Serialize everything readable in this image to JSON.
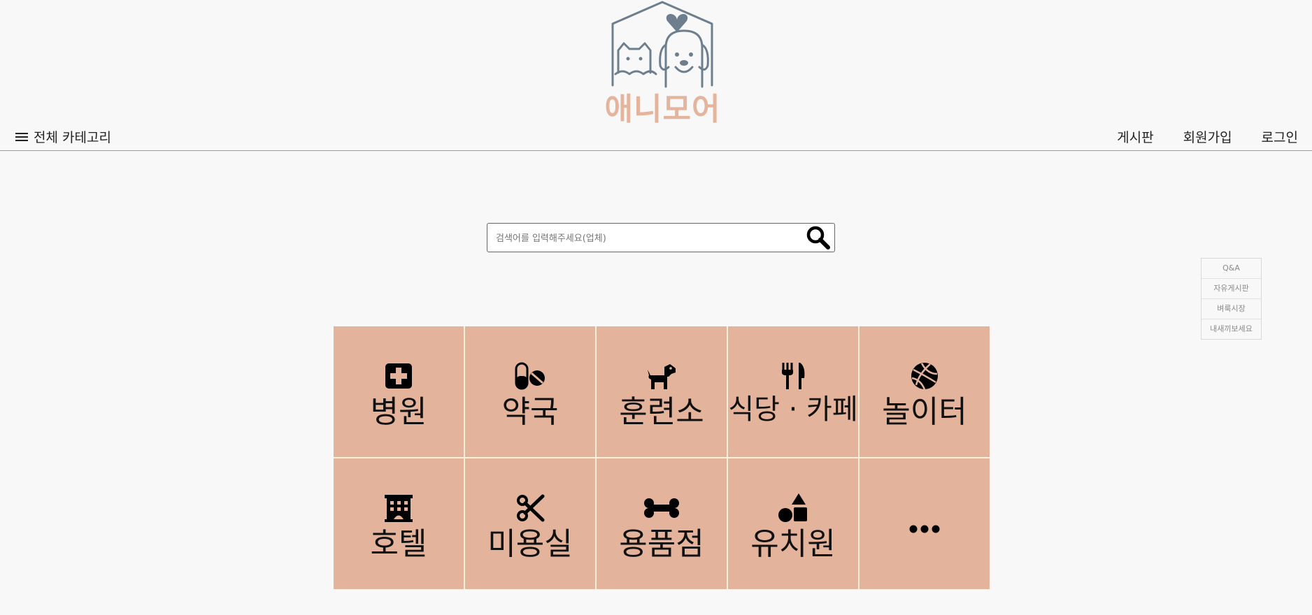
{
  "brand": {
    "name": "애니모어",
    "primary_color": "#e3b39b",
    "logo_color": "#6d7f8e"
  },
  "nav": {
    "category_label": "전체 카테고리",
    "links": [
      "게시판",
      "회원가입",
      "로그인"
    ]
  },
  "search": {
    "placeholder": "검색어를 입력해주세요(업체)"
  },
  "side_menu": [
    "Q&A",
    "자유게시판",
    "벼룩시장",
    "내새끼보세요"
  ],
  "categories": [
    {
      "label": "병원",
      "icon": "hospital-icon"
    },
    {
      "label": "약국",
      "icon": "pill-icon"
    },
    {
      "label": "훈련소",
      "icon": "dog-icon"
    },
    {
      "label": "식당 · 카페",
      "icon": "utensils-icon"
    },
    {
      "label": "놀이터",
      "icon": "ball-icon"
    },
    {
      "label": "호텔",
      "icon": "hotel-icon"
    },
    {
      "label": "미용실",
      "icon": "scissors-icon"
    },
    {
      "label": "용품점",
      "icon": "bone-icon"
    },
    {
      "label": "유치원",
      "icon": "shapes-icon"
    },
    {
      "label": "",
      "icon": "ellipsis-icon"
    }
  ]
}
